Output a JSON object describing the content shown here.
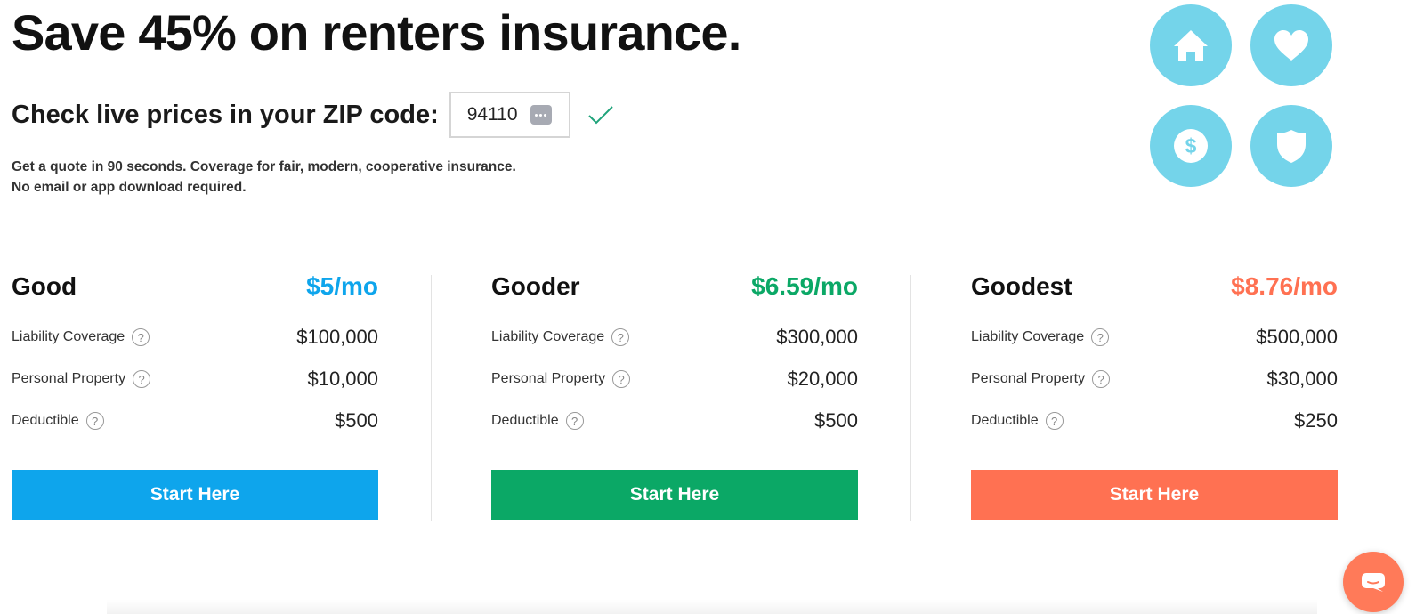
{
  "hero": {
    "headline": "Save 45% on renters insurance.",
    "zip_label": "Check live prices in your ZIP code:",
    "zip_value": "94110",
    "subcopy_line1": "Get a quote in 90 seconds. Coverage for fair, modern, cooperative insurance.",
    "subcopy_line2": "No email or app download required."
  },
  "feature_icons": [
    "home-icon",
    "heart-icon",
    "dollar-icon",
    "shield-icon"
  ],
  "colors": {
    "icon_circle": "#74d4ea",
    "good": "#0ea5ec",
    "gooder": "#0ba866",
    "goodest": "#ff7152",
    "chat": "#ff7a59",
    "check": "#1ea37a"
  },
  "plans": [
    {
      "name": "Good",
      "price": "$5/mo",
      "rows": [
        {
          "label": "Liability Coverage",
          "value": "$100,000"
        },
        {
          "label": "Personal Property",
          "value": "$10,000"
        },
        {
          "label": "Deductible",
          "value": "$500"
        }
      ],
      "cta": "Start Here"
    },
    {
      "name": "Gooder",
      "price": "$6.59/mo",
      "rows": [
        {
          "label": "Liability Coverage",
          "value": "$300,000"
        },
        {
          "label": "Personal Property",
          "value": "$20,000"
        },
        {
          "label": "Deductible",
          "value": "$500"
        }
      ],
      "cta": "Start Here"
    },
    {
      "name": "Goodest",
      "price": "$8.76/mo",
      "rows": [
        {
          "label": "Liability Coverage",
          "value": "$500,000"
        },
        {
          "label": "Personal Property",
          "value": "$30,000"
        },
        {
          "label": "Deductible",
          "value": "$250"
        }
      ],
      "cta": "Start Here"
    }
  ],
  "help_glyph": "?"
}
